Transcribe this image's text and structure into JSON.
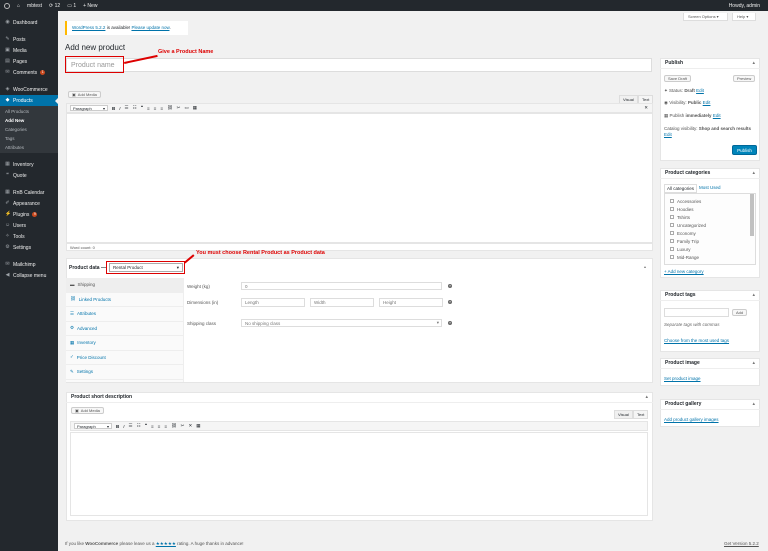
{
  "admin_bar": {
    "site": "mbtest",
    "updates": "12",
    "comments": "1",
    "new": "New",
    "greeting": "Howdy, admin"
  },
  "sidebar": {
    "items": [
      {
        "label": "Dashboard",
        "icon": "dashboard-icon",
        "glyph": "◉"
      },
      {
        "label": "Posts",
        "icon": "pin-icon",
        "glyph": "✎"
      },
      {
        "label": "Media",
        "icon": "media-icon",
        "glyph": "▣"
      },
      {
        "label": "Pages",
        "icon": "pages-icon",
        "glyph": "▤"
      },
      {
        "label": "Comments",
        "icon": "comment-icon",
        "glyph": "✉",
        "badge": "1"
      },
      {
        "label": "WooCommerce",
        "icon": "woo-icon",
        "glyph": "◈"
      },
      {
        "label": "Products",
        "icon": "archive-icon",
        "glyph": "◆",
        "active": true
      },
      {
        "label": "Inventory",
        "icon": "inventory-icon",
        "glyph": "▦"
      },
      {
        "label": "Quote",
        "icon": "quote-icon",
        "glyph": "❝"
      },
      {
        "label": "RnB Calendar",
        "icon": "calendar-icon",
        "glyph": "▦"
      },
      {
        "label": "Appearance",
        "icon": "brush-icon",
        "glyph": "✐"
      },
      {
        "label": "Plugins",
        "icon": "plugin-icon",
        "glyph": "⚡",
        "badge": "9"
      },
      {
        "label": "Users",
        "icon": "users-icon",
        "glyph": "☺"
      },
      {
        "label": "Tools",
        "icon": "wrench-icon",
        "glyph": "✧"
      },
      {
        "label": "Settings",
        "icon": "settings-icon",
        "glyph": "⚙"
      },
      {
        "label": "Mailchimp",
        "icon": "mailchimp-icon",
        "glyph": "✉"
      },
      {
        "label": "Collapse menu",
        "icon": "collapse-icon",
        "glyph": "◀"
      }
    ],
    "products_sub": [
      "All Products",
      "Add New",
      "Categories",
      "Tags",
      "Attributes"
    ]
  },
  "screen_options": "Screen Options ▾",
  "help": "Help ▾",
  "notice": {
    "link1": "WordPress 5.2.2",
    "text": " is available! ",
    "link2": "Please update now",
    "end": "."
  },
  "page_title": "Add new product",
  "title_placeholder": "Product name",
  "annotation1": "Give a Product Name",
  "annotation2": "You must choose Rental Product as Product data",
  "editor": {
    "add_media": "Add Media",
    "visual": "Visual",
    "text": "Text",
    "paragraph": "Paragraph",
    "word_count": "Word count: 0"
  },
  "product_data": {
    "label": "Product data —",
    "type": "Rental Product",
    "tabs": [
      "Shipping",
      "Linked Products",
      "Attributes",
      "Advanced",
      "Inventory",
      "Price Discount",
      "Settings"
    ],
    "weight_label": "Weight (kg)",
    "weight_placeholder": "0",
    "dimensions_label": "Dimensions (in)",
    "length": "Length",
    "width": "Width",
    "height": "Height",
    "shipping_label": "Shipping class",
    "shipping_value": "No shipping class"
  },
  "short_desc": {
    "title": "Product short description",
    "add_media": "Add Media",
    "visual": "Visual",
    "text": "Text",
    "paragraph": "Paragraph"
  },
  "publish": {
    "title": "Publish",
    "save_draft": "Save Draft",
    "preview": "Preview",
    "status": "Status: ",
    "status_value": "Draft",
    "visibility": "Visibility: ",
    "visibility_value": "Public",
    "publish_when": "Publish ",
    "publish_when_value": "immediately",
    "edit": "Edit",
    "catalog": "Catalog visibility: ",
    "catalog_value": "Shop and search results",
    "publish_btn": "Publish"
  },
  "categories": {
    "title": "Product categories",
    "tab_all": "All categories",
    "tab_most": "Most Used",
    "items": [
      "Accessories",
      "Hoodies",
      "Tshirts",
      "Uncategorized",
      "Economy",
      "Family Trip",
      "Luxury",
      "Mid-Range"
    ],
    "add": "+ Add new category"
  },
  "tags": {
    "title": "Product tags",
    "add": "Add",
    "hint": "Separate tags with commas",
    "choose": "Choose from the most used tags"
  },
  "image": {
    "title": "Product image",
    "link": "Set product image"
  },
  "gallery": {
    "title": "Product gallery",
    "link": "Add product gallery images"
  },
  "footer": {
    "pre": "If you like ",
    "brand": "WooCommerce",
    "mid": " please leave us a ",
    "stars": "★★★★★",
    "post": " rating. A huge thanks in advance!",
    "version": "Get Version 5.2.2"
  }
}
